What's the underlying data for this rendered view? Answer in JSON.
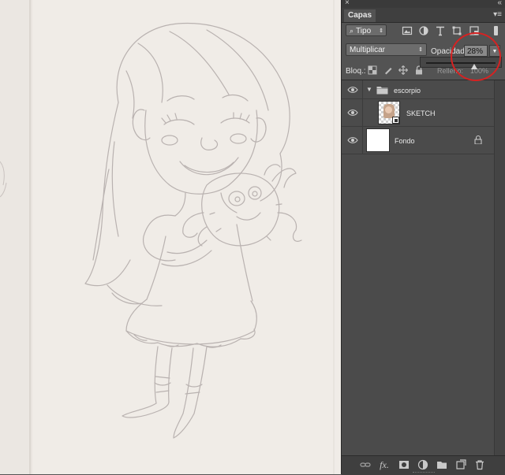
{
  "panel": {
    "tab_label": "Capas",
    "close_glyph": "×",
    "collapse_glyph": "«",
    "menu_glyph": "▾≡",
    "filter": {
      "selected": "Tipo",
      "icons": [
        "image-filter-icon",
        "adjustment-filter-icon",
        "text-filter-icon",
        "shape-filter-icon",
        "smartobject-filter-icon"
      ]
    },
    "blend_mode": "Multiplicar",
    "opacity_label": "Opacidad:",
    "opacity_value": "28%",
    "opacity_level_percent": 28,
    "lock_label": "Bloq.:",
    "fill_label": "Relleno:",
    "fill_value": "100%",
    "highlight_color": "#d62222"
  },
  "layers": [
    {
      "name": "escorpio",
      "type": "group",
      "expanded": true,
      "visible": true
    },
    {
      "name": "SKETCH",
      "type": "smart-object",
      "visible": true,
      "selected": false
    },
    {
      "name": "Fondo",
      "type": "background",
      "visible": true,
      "locked": true
    }
  ],
  "bottom_bar": {
    "fx_label": "fx.",
    "icons": [
      "link-icon",
      "fx-icon",
      "mask-icon",
      "adjustment-icon",
      "folder-icon",
      "new-layer-icon",
      "trash-icon"
    ]
  },
  "colors": {
    "panel_bg": "#535353",
    "list_bg": "#4b4b4b",
    "canvas_paper": "#efebe6",
    "pencil": "#b9b2b0"
  }
}
